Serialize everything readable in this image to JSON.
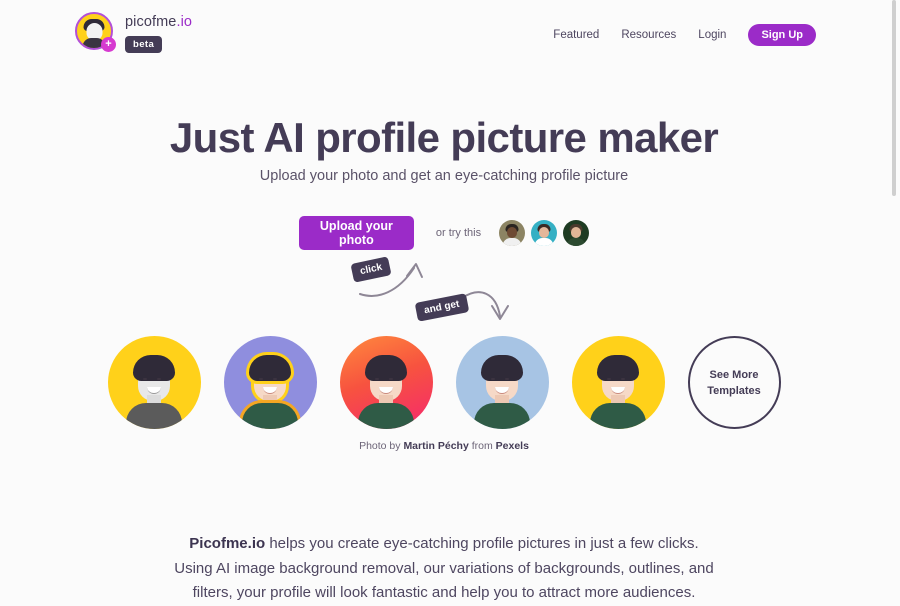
{
  "brand": {
    "name_main": "picofme",
    "name_tld": ".io",
    "badge": "beta",
    "logo_icon": "avatar-plus-icon",
    "plus_glyph": "+"
  },
  "nav": {
    "links": [
      {
        "label": "Featured"
      },
      {
        "label": "Resources"
      },
      {
        "label": "Login"
      }
    ],
    "signup_label": "Sign Up"
  },
  "hero": {
    "title": "Just AI profile picture maker",
    "subtitle": "Upload your photo and get an eye-catching profile picture"
  },
  "cta": {
    "upload_label": "Upload your photo",
    "or_try_label": "or try this",
    "sample_avatars": [
      {
        "name": "sample-avatar-1",
        "bg": "#8c8463",
        "hair": "#2a2420",
        "skin": "#6e4a33",
        "shirt": "#f0f0f0"
      },
      {
        "name": "sample-avatar-2",
        "bg": "#35b0c4",
        "hair": "#3a2a24",
        "skin": "#e3b79a",
        "shirt": "#ffffff"
      },
      {
        "name": "sample-avatar-3",
        "bg": "#1e3b22",
        "hair": "#4a3a2c",
        "skin": "#e0b696",
        "shirt": "#2c4a30"
      }
    ]
  },
  "annotations": {
    "click_label": "click",
    "and_get_label": "and get"
  },
  "templates": {
    "items": [
      {
        "name": "template-yellow-grayscale",
        "bg": "#ffd11a",
        "style": "gray"
      },
      {
        "name": "template-periwinkle-outline",
        "bg": "#8f8ede",
        "style": "outlined"
      },
      {
        "name": "template-orange-pink-gradient",
        "bg": "linear-gradient(160deg,#ff8a3d 0%,#f7533f 45%,#f5286e 100%)",
        "style": "color"
      },
      {
        "name": "template-light-blue",
        "bg": "#a7c4e4",
        "style": "color"
      },
      {
        "name": "template-yellow",
        "bg": "#ffd11a",
        "style": "color"
      }
    ],
    "see_more_label": "See More\nTemplates"
  },
  "credit": {
    "prefix": "Photo by ",
    "author": "Martin Péchy",
    "middle": " from ",
    "source": "Pexels"
  },
  "blurb": {
    "brand": "Picofme.io",
    "line1_rest": " helps you create eye-catching profile pictures in just a few clicks.",
    "line2": "Using AI image background removal, our variations of backgrounds, outlines, and",
    "line3": "filters, your profile will look fantastic and help you to attract more audiences."
  },
  "colors": {
    "accent_purple": "#9b2bc8",
    "ink": "#443c56",
    "yellow": "#ffd11a",
    "page_bg": "#fbfbfb"
  }
}
